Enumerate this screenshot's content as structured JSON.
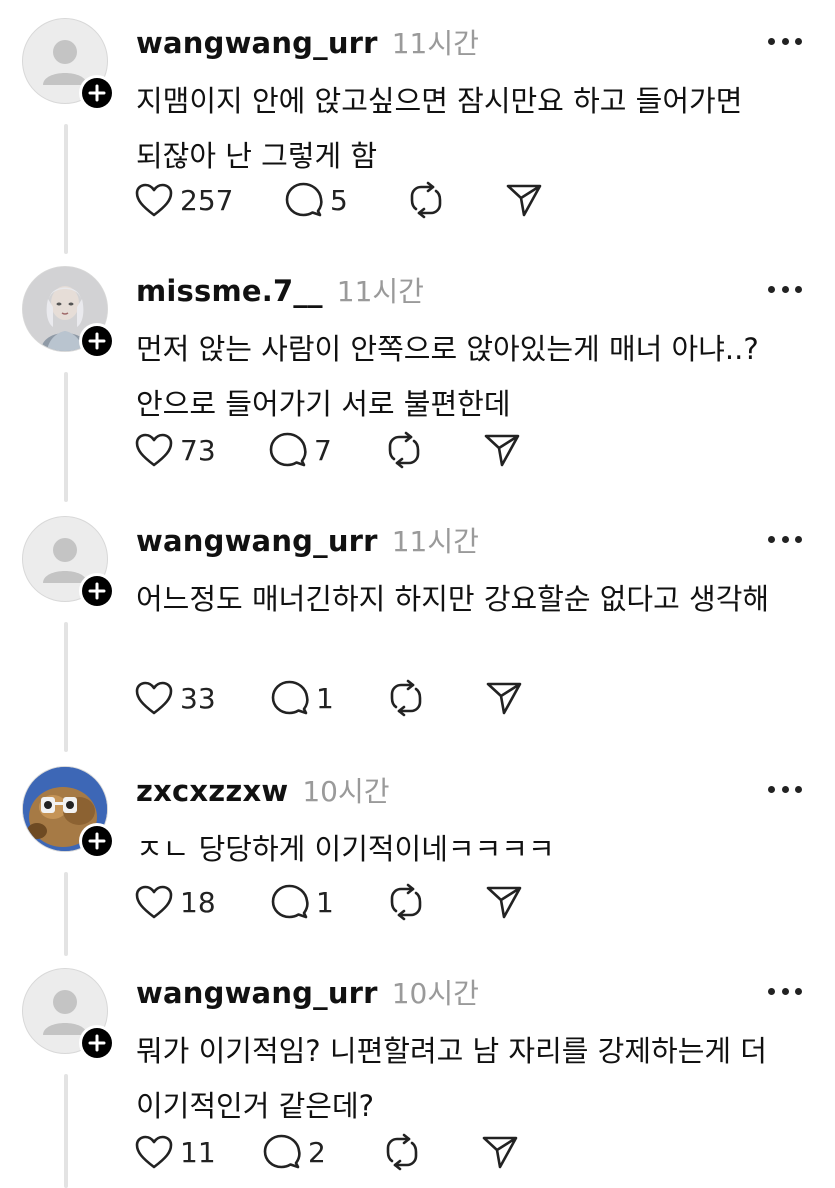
{
  "comments": [
    {
      "username": "wangwang_urr",
      "time": "11시간",
      "text": "지맴이지 안에 앉고싶으면 잠시만요 하고 들어가면 되잖아 난 그렇게 함",
      "likes": "257",
      "replies": "5",
      "avatar": "default-avatar-icon"
    },
    {
      "username": "missme.7__",
      "time": "11시간",
      "text": "먼저 앉는 사람이 안쪽으로 앉아있는게 매너 아냐..? 안으로 들어가기 서로 불편한데",
      "likes": "73",
      "replies": "7",
      "avatar": "profile-photo"
    },
    {
      "username": "wangwang_urr",
      "time": "11시간",
      "text": "어느정도 매너긴하지 하지만 강요할순 없다고 생각해",
      "likes": "33",
      "replies": "1",
      "avatar": "default-avatar-icon"
    },
    {
      "username": "zxcxzzxw",
      "time": "10시간",
      "text": "ㅈㄴ 당당하게 이기적이네ㅋㅋㅋㅋ",
      "likes": "18",
      "replies": "1",
      "avatar": "profile-photo"
    },
    {
      "username": "wangwang_urr",
      "time": "10시간",
      "text": "뭐가 이기적임? 니편할려고 남 자리를 강제하는게 더 이기적인거 같은데?",
      "likes": "11",
      "replies": "2",
      "avatar": "default-avatar-icon"
    }
  ],
  "icons": {
    "like": "heart-icon",
    "reply": "comment-icon",
    "repost": "repost-icon",
    "share": "send-icon",
    "more": "more-dots-icon",
    "follow": "plus-icon"
  },
  "colors": {
    "text": "#111111",
    "muted": "#9a9a9a",
    "thread_line": "#e3e3e3"
  }
}
